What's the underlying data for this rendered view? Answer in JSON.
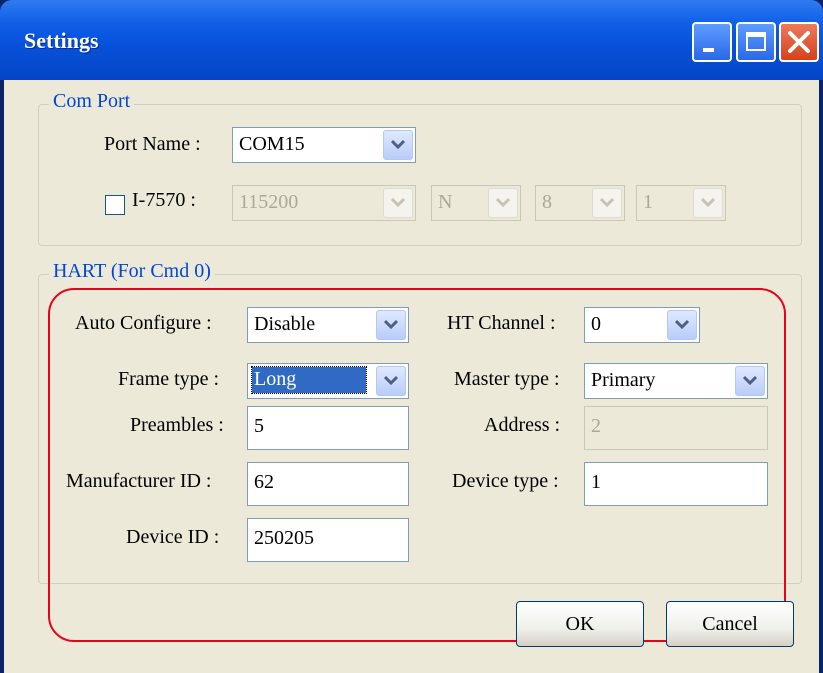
{
  "window": {
    "title": "Settings"
  },
  "com_port": {
    "legend": "Com Port",
    "port_name_label": "Port Name :",
    "port_name_value": "COM15",
    "i7570_label": "I-7570 :",
    "i7570_checked": false,
    "baud": "115200",
    "parity": "N",
    "data_bits": "8",
    "stop_bits": "1"
  },
  "hart": {
    "legend": "HART (For Cmd 0)",
    "auto_configure_label": "Auto Configure :",
    "auto_configure_value": "Disable",
    "frame_type_label": "Frame type :",
    "frame_type_value": "Long",
    "preambles_label": "Preambles :",
    "preambles_value": "5",
    "manufacturer_id_label": "Manufacturer ID :",
    "manufacturer_id_value": "62",
    "device_id_label": "Device ID :",
    "device_id_value": "250205",
    "ht_channel_label": "HT Channel :",
    "ht_channel_value": "0",
    "master_type_label": "Master type :",
    "master_type_value": "Primary",
    "address_label": "Address :",
    "address_value": "2",
    "device_type_label": "Device type :",
    "device_type_value": "1"
  },
  "buttons": {
    "ok": "OK",
    "cancel": "Cancel"
  },
  "colors": {
    "title_bar": "#0650d8",
    "dialog_bg": "#ece9d8",
    "group_legend": "#0046d5",
    "annotation": "#e8001c",
    "selection": "#316ac5"
  },
  "icons": {
    "minimize": "minimize-icon",
    "maximize": "maximize-icon",
    "close": "close-icon",
    "dropdown": "chevron-down-icon"
  }
}
